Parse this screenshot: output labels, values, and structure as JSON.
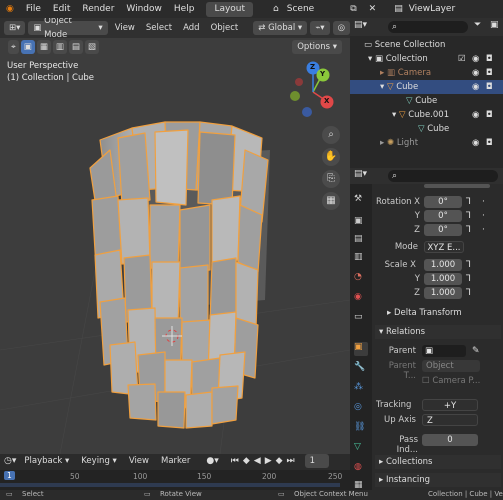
{
  "topbar": {
    "menus": [
      "File",
      "Edit",
      "Render",
      "Window",
      "Help"
    ],
    "workspace_tab": "Layout",
    "scene": "Scene",
    "view_layer": "ViewLayer"
  },
  "viewport": {
    "mode": "Object Mode",
    "menus": [
      "View",
      "Select",
      "Add",
      "Object"
    ],
    "orientation": "Global",
    "options": "Options",
    "perspective": "User Perspective",
    "collection_info": "(1) Collection | Cube",
    "gizmo": {
      "x": "X",
      "y": "Y",
      "z": "Z"
    }
  },
  "outliner": {
    "search_placeholder": "",
    "items": [
      "Scene Collection",
      "Collection",
      "Camera",
      "Cube",
      "Cube",
      "Cube.001",
      "Cube",
      "Light"
    ]
  },
  "properties": {
    "rotation_label": "Rotation",
    "rot_x": "0°",
    "rot_y": "0°",
    "rot_z": "0°",
    "axis_x": "X",
    "axis_y": "Y",
    "axis_z": "Z",
    "mode_label": "Mode",
    "mode_value": "XYZ E...",
    "scale_label": "Scale X",
    "scale_x": "1.000",
    "scale_y": "1.000",
    "scale_z": "1.000",
    "delta_transform": "Delta Transform",
    "relations": "Relations",
    "parent_label": "Parent",
    "parent_type_label": "Parent T...",
    "parent_type_value": "Object",
    "camera_parent": "Camera P...",
    "tracking_label": "Tracking",
    "tracking_value": "+Y",
    "up_axis_label": "Up Axis",
    "up_axis_value": "Z",
    "pass_index_label": "Pass Ind...",
    "pass_index_value": "0",
    "collections": "Collections",
    "instancing": "Instancing"
  },
  "timeline": {
    "menus": [
      "Playback",
      "Keying",
      "View",
      "Marker"
    ],
    "frame_labels": [
      "1",
      "50",
      "100",
      "150",
      "200",
      "250"
    ],
    "current_frame": "1"
  },
  "status": {
    "select": "Select",
    "rotate": "Rotate View",
    "context": "Object Context Menu",
    "info": "Collection | Cube | Ve"
  }
}
